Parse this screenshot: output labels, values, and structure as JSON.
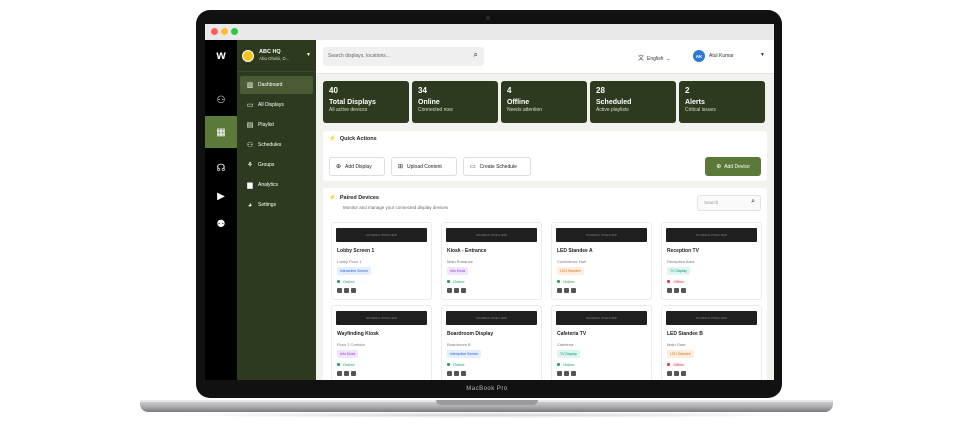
{
  "device": {
    "model_label": "MacBook Pro"
  },
  "sidebar_rail": {
    "items": [
      {
        "icon": "network-icon",
        "glyph": "⚇"
      },
      {
        "icon": "calendar-icon",
        "glyph": "▦",
        "active": true
      },
      {
        "icon": "headset-icon",
        "glyph": "☊"
      },
      {
        "icon": "play-icon",
        "glyph": "▶"
      },
      {
        "icon": "team-icon",
        "glyph": "⚉"
      }
    ]
  },
  "org": {
    "name": "ABC HQ",
    "location": "Abu Dhabi, D..."
  },
  "nav": {
    "items": [
      {
        "label": "Dashboard",
        "icon": "chart-icon",
        "glyph": "▥",
        "active": true
      },
      {
        "label": "All Displays",
        "icon": "folder-icon",
        "glyph": "▭"
      },
      {
        "label": "Playlist",
        "icon": "playlist-icon",
        "glyph": "▤"
      },
      {
        "label": "Schedules",
        "icon": "users-icon",
        "glyph": "⚇"
      },
      {
        "label": "Groups",
        "icon": "groups-icon",
        "glyph": "⚘"
      },
      {
        "label": "Analytics",
        "icon": "analytics-icon",
        "glyph": "▆"
      },
      {
        "label": "Settings",
        "icon": "settings-icon",
        "glyph": "◕"
      }
    ]
  },
  "header": {
    "search_placeholder": "Search displays, locations...",
    "language": "English",
    "user_initials": "AK",
    "user_name": "Atul Kumar"
  },
  "stats": [
    {
      "value": "40",
      "label": "Total Displays",
      "sub": "All active devices"
    },
    {
      "value": "34",
      "label": "Online",
      "sub": "Connected now"
    },
    {
      "value": "4",
      "label": "Offline",
      "sub": "Needs attention"
    },
    {
      "value": "28",
      "label": "Scheduled",
      "sub": "Active playlists"
    },
    {
      "value": "2",
      "label": "Alerts",
      "sub": "Critical issues"
    }
  ],
  "quick_actions": {
    "title": "Quick Actions",
    "buttons": [
      {
        "label": "Add Display",
        "glyph": "⊕"
      },
      {
        "label": "Upload Content",
        "glyph": "⊞"
      },
      {
        "label": "Create Schedule",
        "glyph": "▭"
      }
    ],
    "add_device_label": "Add Device"
  },
  "paired_devices": {
    "title": "Paired Devices",
    "subtitle": "Monitor and manage your connected display devices",
    "search_placeholder": "Search",
    "preview_label": "SCREEN PREVIEW",
    "devices": [
      {
        "name": "Lobby Screen 1",
        "location": "Lobby Floor 1",
        "tag": "Interactive Screen",
        "tag_color": "#e3eeff",
        "tag_text": "#2a5bd7",
        "status": "Online",
        "status_color": "#1aa05a"
      },
      {
        "name": "Kiosk - Entrance",
        "location": "Main Entrance",
        "tag": "Info Kiosk",
        "tag_color": "#f1e4ff",
        "tag_text": "#8a3ad6",
        "status": "Online",
        "status_color": "#1aa05a"
      },
      {
        "name": "LED Standee A",
        "location": "Conference Hall",
        "tag": "LED Standee",
        "tag_color": "#ffeede",
        "tag_text": "#d9731c",
        "status": "Online",
        "status_color": "#1aa05a"
      },
      {
        "name": "Reception TV",
        "location": "Reception Area",
        "tag": "TV Display",
        "tag_color": "#ddf6f1",
        "tag_text": "#15937e",
        "status": "Offline",
        "status_color": "#e0323a"
      },
      {
        "name": "Wayfinding Kiosk",
        "location": "Floor 2 Corridor",
        "tag": "Info Kiosk",
        "tag_color": "#f1e4ff",
        "tag_text": "#8a3ad6",
        "status": "Online",
        "status_color": "#1aa05a"
      },
      {
        "name": "Boardroom Display",
        "location": "Boardroom B",
        "tag": "Interactive Screen",
        "tag_color": "#e3eeff",
        "tag_text": "#2a5bd7",
        "status": "Online",
        "status_color": "#1aa05a"
      },
      {
        "name": "Cafeteria TV",
        "location": "Cafeteria",
        "tag": "TV Display",
        "tag_color": "#ddf6f1",
        "tag_text": "#15937e",
        "status": "Online",
        "status_color": "#1aa05a"
      },
      {
        "name": "LED Standee B",
        "location": "Main Gate",
        "tag": "LED Standee",
        "tag_color": "#ffeede",
        "tag_text": "#d9731c",
        "status": "Offline",
        "status_color": "#e0323a"
      }
    ]
  }
}
